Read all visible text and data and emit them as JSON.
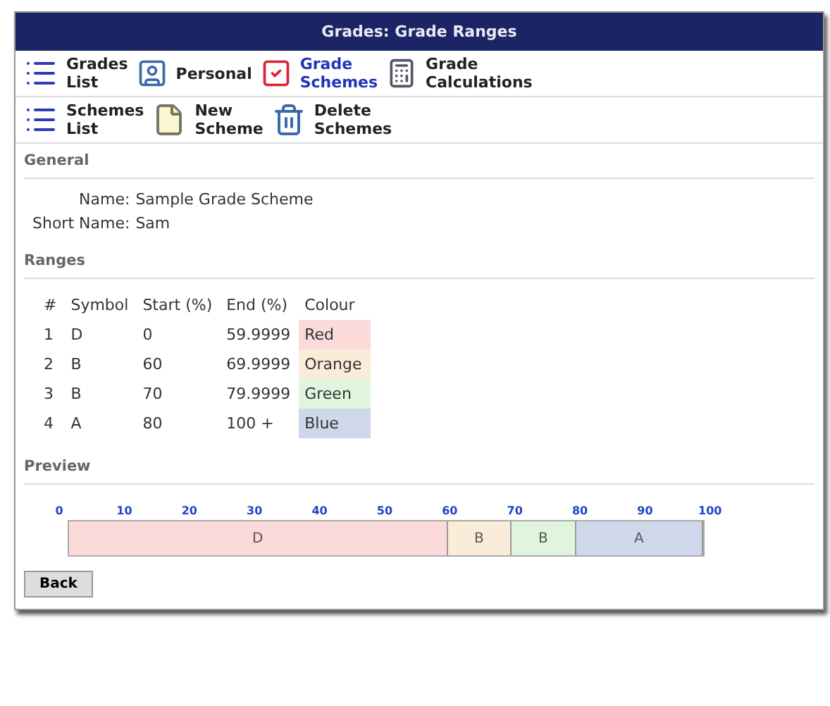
{
  "window": {
    "title": "Grades: Grade Ranges"
  },
  "toolbars": [
    [
      {
        "label": "Grades List",
        "selected": false
      },
      {
        "label": "Personal",
        "selected": false
      },
      {
        "label": "Grade Schemes",
        "selected": true
      },
      {
        "label": "Grade Calculations",
        "selected": false
      }
    ],
    [
      {
        "label": "Schemes List",
        "selected": false
      },
      {
        "label": "New Scheme",
        "selected": false
      },
      {
        "label": "Delete Schemes",
        "selected": false
      }
    ]
  ],
  "general": {
    "heading": "General",
    "fields": [
      {
        "label": "Name:",
        "value": "Sample Grade Scheme"
      },
      {
        "label": "Short Name:",
        "value": "Sam"
      }
    ]
  },
  "ranges": {
    "heading": "Ranges",
    "columns": [
      "#",
      "Symbol",
      "Start (%)",
      "End (%)",
      "Colour"
    ],
    "rows": [
      {
        "index": "1",
        "symbol": "D",
        "start": "0",
        "end": "59.9999",
        "colour": "Red",
        "color": "#fbdada"
      },
      {
        "index": "2",
        "symbol": "B",
        "start": "60",
        "end": "69.9999",
        "colour": "Orange",
        "color": "#fbecd9"
      },
      {
        "index": "3",
        "symbol": "B",
        "start": "70",
        "end": "79.9999",
        "colour": "Green",
        "color": "#e0f5de"
      },
      {
        "index": "4",
        "symbol": "A",
        "start": "80",
        "end": "100 +",
        "colour": "Blue",
        "color": "#cfd8ea"
      }
    ]
  },
  "preview": {
    "heading": "Preview",
    "ticks": [
      "0",
      "10",
      "20",
      "30",
      "40",
      "50",
      "60",
      "70",
      "80",
      "90",
      "100"
    ],
    "segments": [
      {
        "label": "D",
        "color": "#fbdada"
      },
      {
        "label": "B",
        "color": "#fbecd9"
      },
      {
        "label": "B",
        "color": "#e0f5de"
      },
      {
        "label": "A",
        "color": "#cfd8ea"
      }
    ]
  },
  "buttons": [
    "Back"
  ]
}
